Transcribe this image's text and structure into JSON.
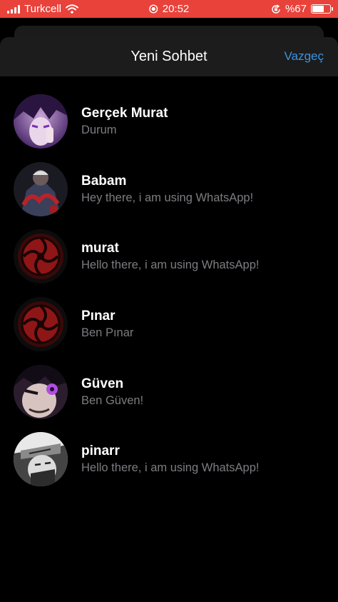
{
  "status_bar": {
    "carrier": "Turkcell",
    "time": "20:52",
    "battery_percent": "%67",
    "battery_level": 0.67,
    "background_color": "#e8423a"
  },
  "nav": {
    "title": "Yeni Sohbet",
    "cancel_label": "Vazgeç",
    "accent_color": "#3a93e0"
  },
  "contacts": [
    {
      "name": "Gerçek Murat",
      "status": "Durum",
      "avatar": "purple-anime-character-avatar"
    },
    {
      "name": "Babam",
      "status": "Hey there, i am using WhatsApp!",
      "avatar": "dark-red-anime-character-avatar"
    },
    {
      "name": "murat",
      "status": "Hello there, i am using WhatsApp!",
      "avatar": "red-sharingan-avatar"
    },
    {
      "name": "Pınar",
      "status": "Ben Pınar",
      "avatar": "red-sharingan-avatar"
    },
    {
      "name": "Güven",
      "status": "Ben Güven!",
      "avatar": "purple-eye-character-avatar"
    },
    {
      "name": "pinarr",
      "status": "Hello there, i am using WhatsApp!",
      "avatar": "masked-ninja-avatar"
    }
  ]
}
